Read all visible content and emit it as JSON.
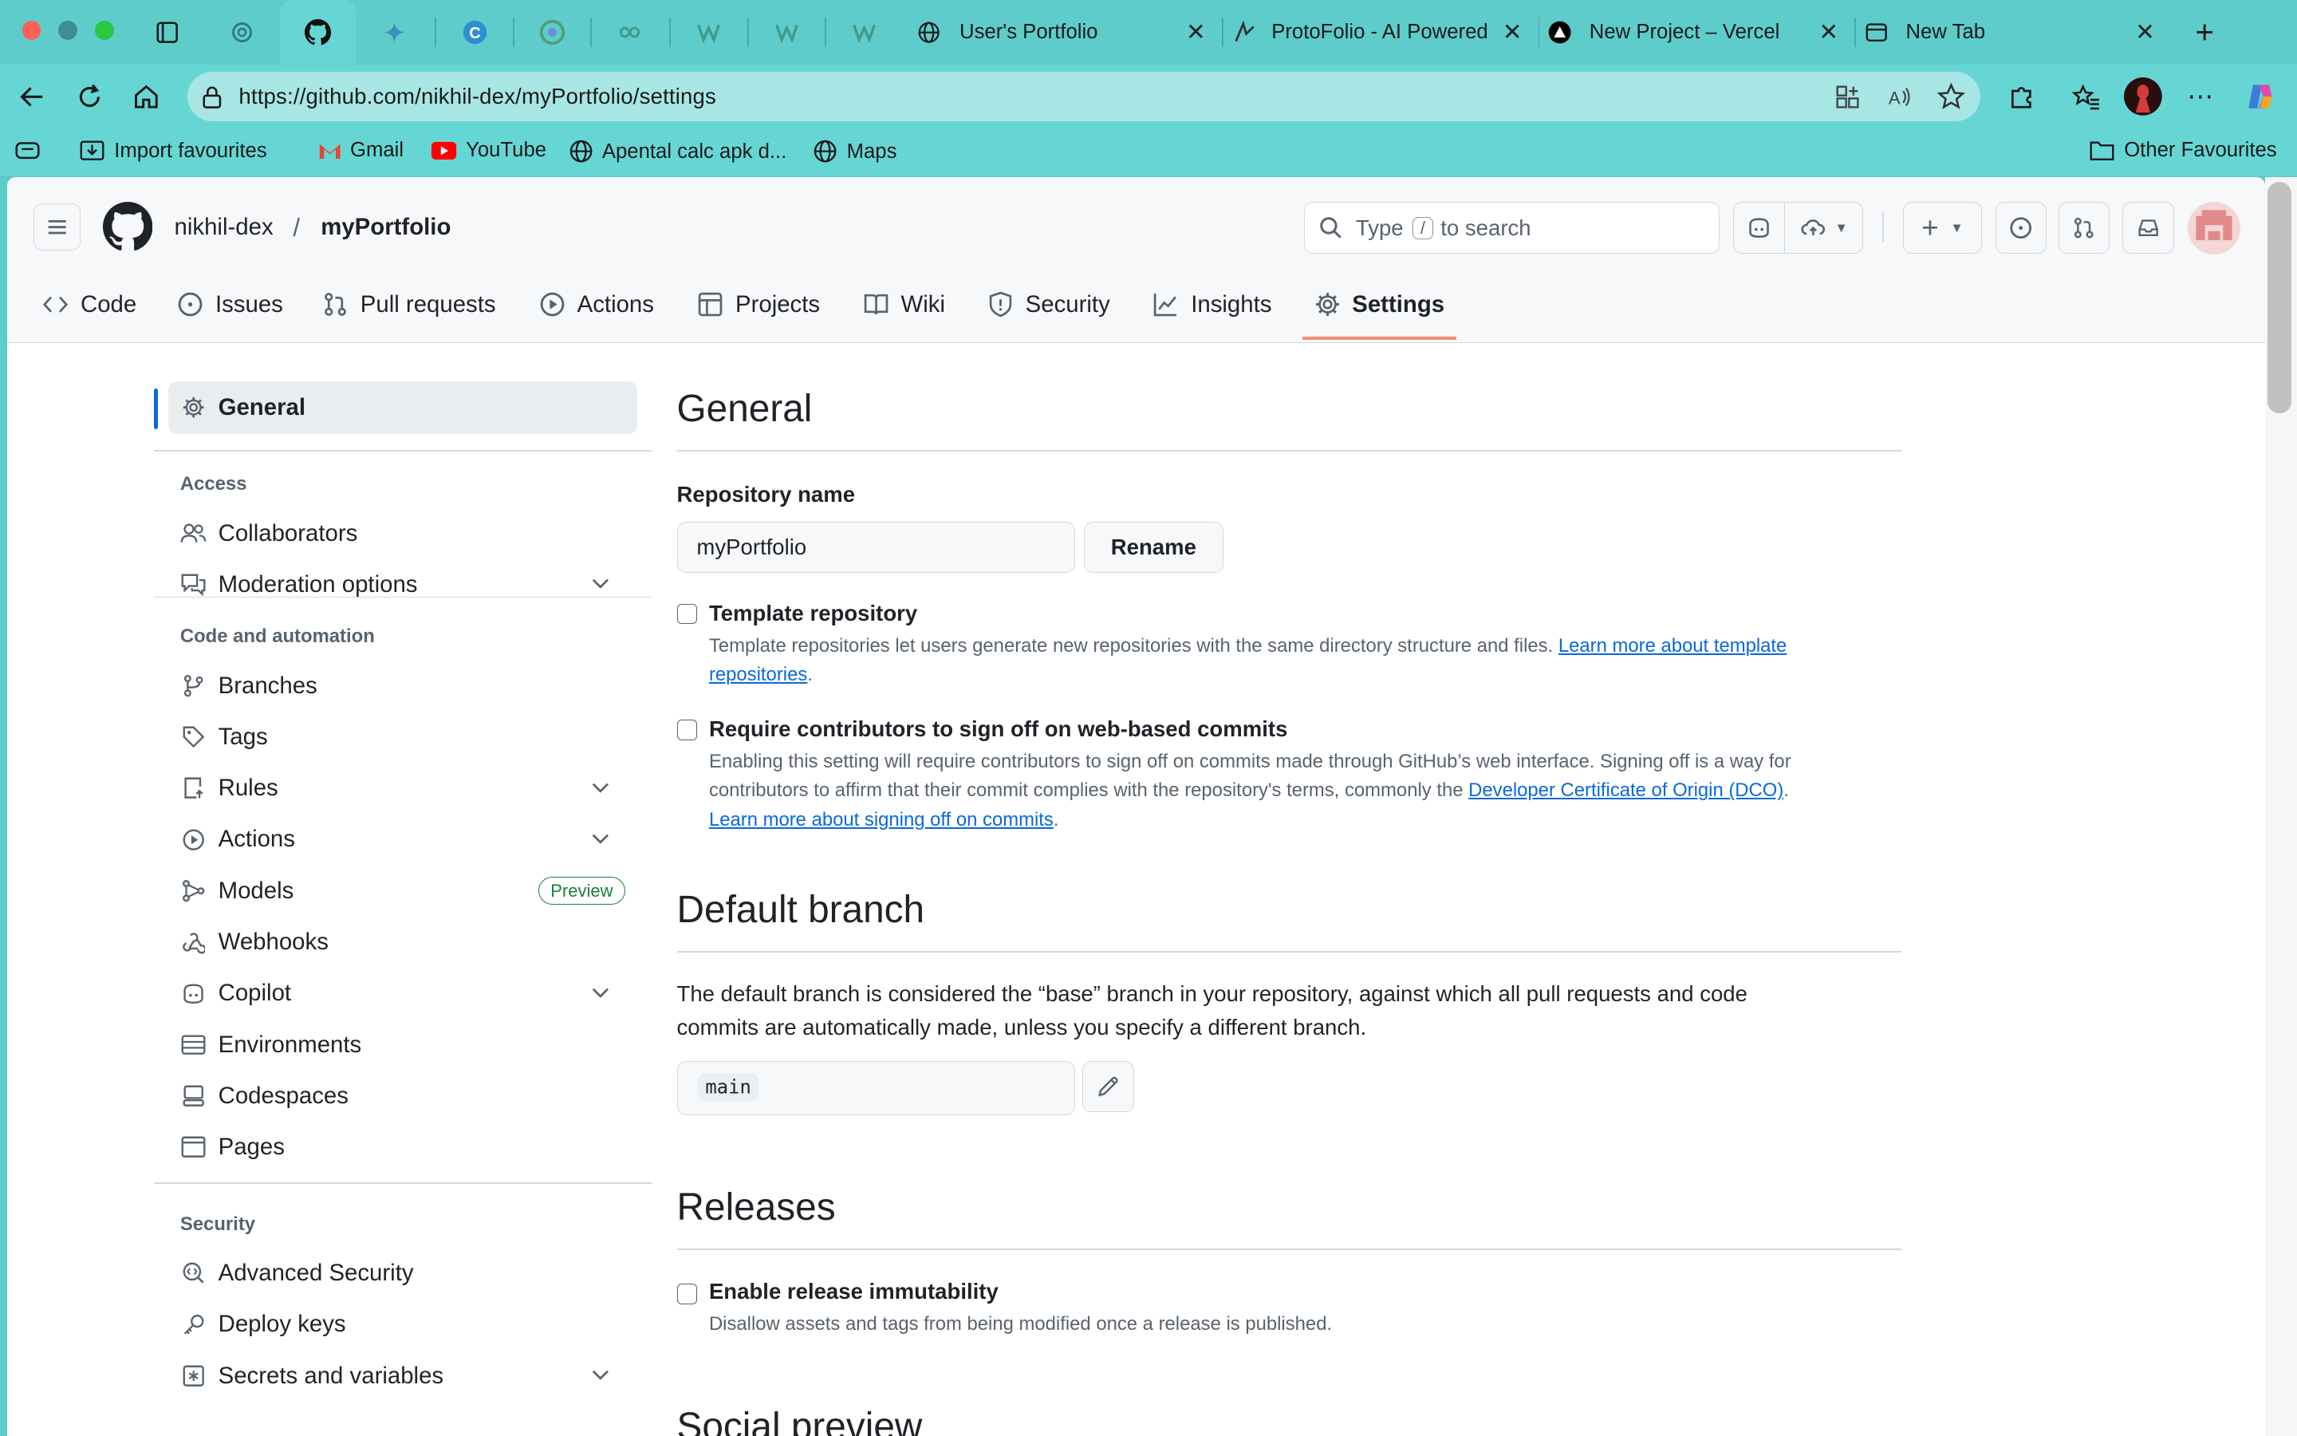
{
  "browser": {
    "tabs": [
      {
        "title": "User's Portfolio"
      },
      {
        "title": "ProtoFolio - AI Powered"
      },
      {
        "title": "New Project – Vercel"
      },
      {
        "title": "New Tab"
      }
    ],
    "url": "https://github.com/nikhil-dex/myPortfolio/settings",
    "bookmarks": [
      "Import favourites",
      "Gmail",
      "YouTube",
      "Apental calc apk d...",
      "Maps"
    ],
    "other_favourites": "Other Favourites"
  },
  "github": {
    "owner": "nikhil-dex",
    "separator": "/",
    "repo": "myPortfolio",
    "search": {
      "pre": "Type",
      "key": "/",
      "post": "to search"
    },
    "nav": [
      "Code",
      "Issues",
      "Pull requests",
      "Actions",
      "Projects",
      "Wiki",
      "Security",
      "Insights",
      "Settings"
    ]
  },
  "sidebar": {
    "general": "General",
    "access_heading": "Access",
    "access": [
      "Collaborators",
      "Moderation options"
    ],
    "code_heading": "Code and automation",
    "code": [
      "Branches",
      "Tags",
      "Rules",
      "Actions",
      "Models",
      "Webhooks",
      "Copilot",
      "Environments",
      "Codespaces",
      "Pages"
    ],
    "models_badge": "Preview",
    "security_heading": "Security",
    "security": [
      "Advanced Security",
      "Deploy keys",
      "Secrets and variables"
    ]
  },
  "main": {
    "general_title": "General",
    "repo_name_label": "Repository name",
    "repo_name_value": "myPortfolio",
    "rename_button": "Rename",
    "template": {
      "title": "Template repository",
      "desc": "Template repositories let users generate new repositories with the same directory structure and files.",
      "link1": "Learn more about template",
      "link2": "repositories",
      "end": "."
    },
    "signoff": {
      "title": "Require contributors to sign off on web-based commits",
      "desc1": "Enabling this setting will require contributors to sign off on commits made through GitHub’s web interface. Signing off is a way for",
      "desc2": "contributors to affirm that their commit complies with the repository's terms, commonly the",
      "link_dco": "Developer Certificate of Origin (DCO)",
      "dot": ".",
      "link_learn": "Learn more about signing off on commits",
      "end": "."
    },
    "default_branch_title": "Default branch",
    "default_branch_desc1": "The default branch is considered the “base” branch in your repository, against which all pull requests and code",
    "default_branch_desc2": "commits are automatically made, unless you specify a different branch.",
    "default_branch_value": "main",
    "releases_title": "Releases",
    "immutability": {
      "title": "Enable release immutability",
      "desc": "Disallow assets and tags from being modified once a release is published."
    },
    "social_preview_title": "Social preview"
  }
}
